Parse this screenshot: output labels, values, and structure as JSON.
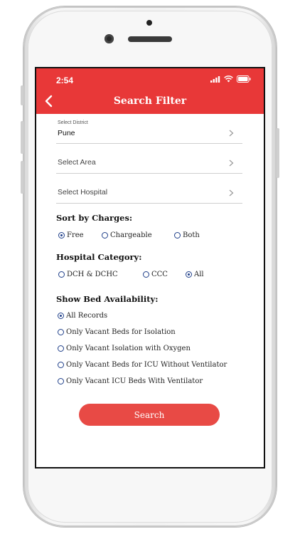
{
  "status": {
    "time": "2:54"
  },
  "header": {
    "title": "Search Filter"
  },
  "filters": {
    "district": {
      "label": "Select District",
      "value": "Pune"
    },
    "area": {
      "placeholder": "Select Area"
    },
    "hospital": {
      "placeholder": "Select Hospital"
    }
  },
  "sort": {
    "title": "Sort by Charges:",
    "options": [
      {
        "label": "Free",
        "selected": true
      },
      {
        "label": "Chargeable",
        "selected": false
      },
      {
        "label": "Both",
        "selected": false
      }
    ]
  },
  "category": {
    "title": "Hospital Category:",
    "options": [
      {
        "label": "DCH & DCHC",
        "selected": false
      },
      {
        "label": "CCC",
        "selected": false
      },
      {
        "label": "All",
        "selected": true
      }
    ]
  },
  "beds": {
    "title": "Show Bed Availability:",
    "options": [
      {
        "label": "All Records",
        "selected": true
      },
      {
        "label": "Only Vacant Beds for Isolation",
        "selected": false
      },
      {
        "label": "Only Vacant Isolation with Oxygen",
        "selected": false
      },
      {
        "label": "Only Vacant Beds for ICU Without Ventilator",
        "selected": false
      },
      {
        "label": "Only Vacant ICU Beds With Ventilator",
        "selected": false
      }
    ]
  },
  "actions": {
    "search_label": "Search"
  },
  "colors": {
    "accent": "#e83838",
    "radio": "#1f3f8a",
    "button": "#e84a45"
  }
}
